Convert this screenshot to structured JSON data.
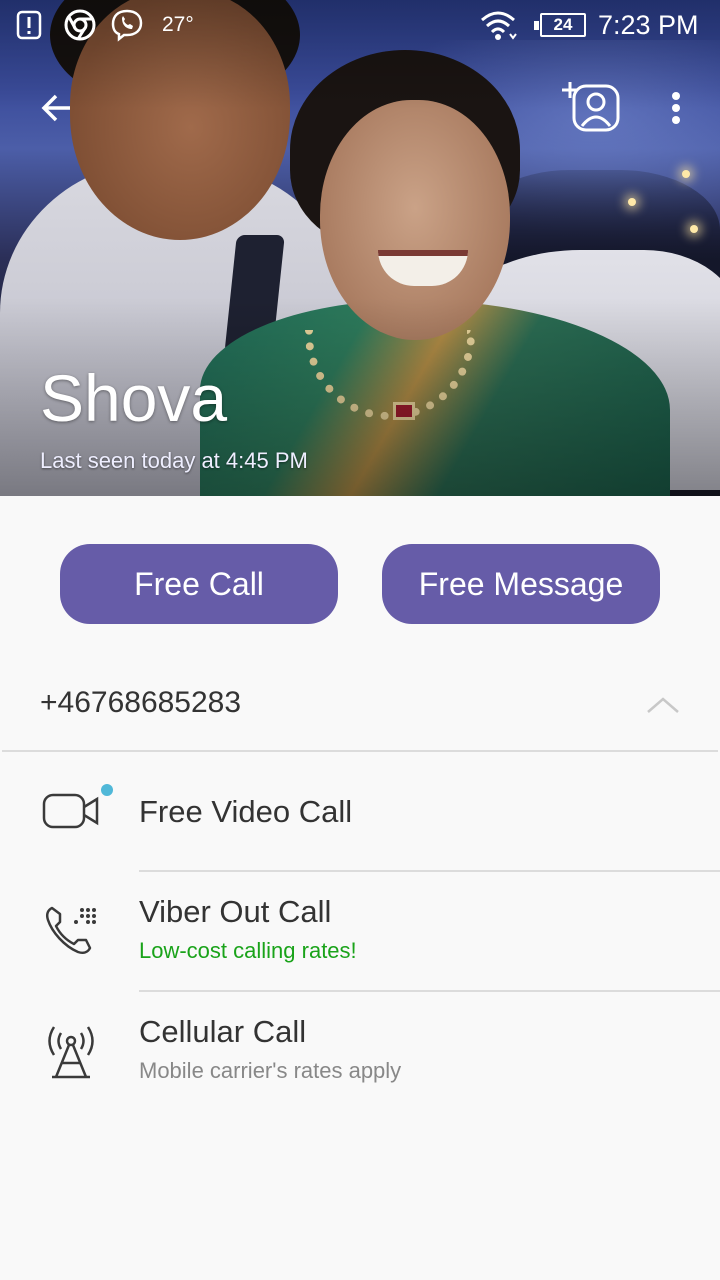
{
  "status_bar": {
    "temperature": "27°",
    "battery": "24",
    "time": "7:23 PM"
  },
  "contact": {
    "name": "Shova",
    "last_seen": "Last seen today at 4:45 PM",
    "phone": "+46768685283"
  },
  "actions": {
    "free_call": "Free Call",
    "free_message": "Free Message"
  },
  "options": [
    {
      "title": "Free Video Call",
      "subtitle": ""
    },
    {
      "title": "Viber Out Call",
      "subtitle": "Low-cost calling rates!"
    },
    {
      "title": "Cellular Call",
      "subtitle": "Mobile carrier's rates apply"
    }
  ],
  "colors": {
    "accent": "#665ca8",
    "promo_green": "#1aa31a",
    "subtitle_gray": "#888888",
    "badge_dot": "#50b8d8"
  },
  "icons": {
    "back": "arrow-back-icon",
    "add_contact": "add-contact-icon",
    "more": "more-vert-icon",
    "video": "video-camera-icon",
    "viber_out": "phone-dialpad-icon",
    "cellular": "antenna-icon",
    "collapse": "chevron-up-icon"
  }
}
